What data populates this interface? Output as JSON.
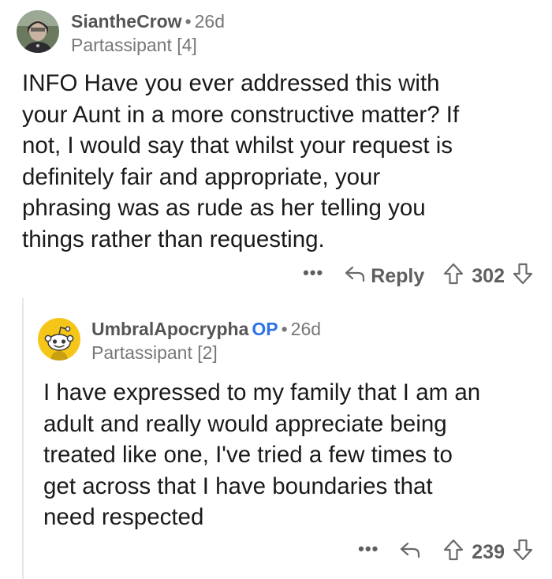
{
  "comments": [
    {
      "username": "SiantheCrow",
      "age": "26d",
      "flair": "Partassipant [4]",
      "body_lines": [
        "INFO Have you ever addressed this with",
        "your Aunt in a more constructive matter?  If",
        "not, I would say that whilst your request is",
        "definitely fair and appropriate, your",
        "phrasing was as rude as her telling you",
        "things rather than requesting."
      ],
      "more_label": "•••",
      "reply_label": "Reply",
      "score": "302"
    },
    {
      "username": "UmbralApocrypha",
      "op_badge": "OP",
      "age": "26d",
      "flair": "Partassipant [2]",
      "body_lines": [
        "I have expressed to my family that I am an",
        "adult and really would appreciate being",
        "treated like one, I've tried a few times to",
        "get across that I have boundaries that",
        "need respected"
      ],
      "more_label": "•••",
      "score": "239"
    }
  ],
  "separator": "•",
  "colors": {
    "op_blue": "#2d72e6",
    "meta_gray": "#777777",
    "avatar2_yellow": "#f5c518"
  },
  "icons": [
    "avatar-photo",
    "reply-arrow-icon",
    "upvote-arrow-icon",
    "downvote-arrow-icon",
    "snoo-avatar-icon"
  ]
}
